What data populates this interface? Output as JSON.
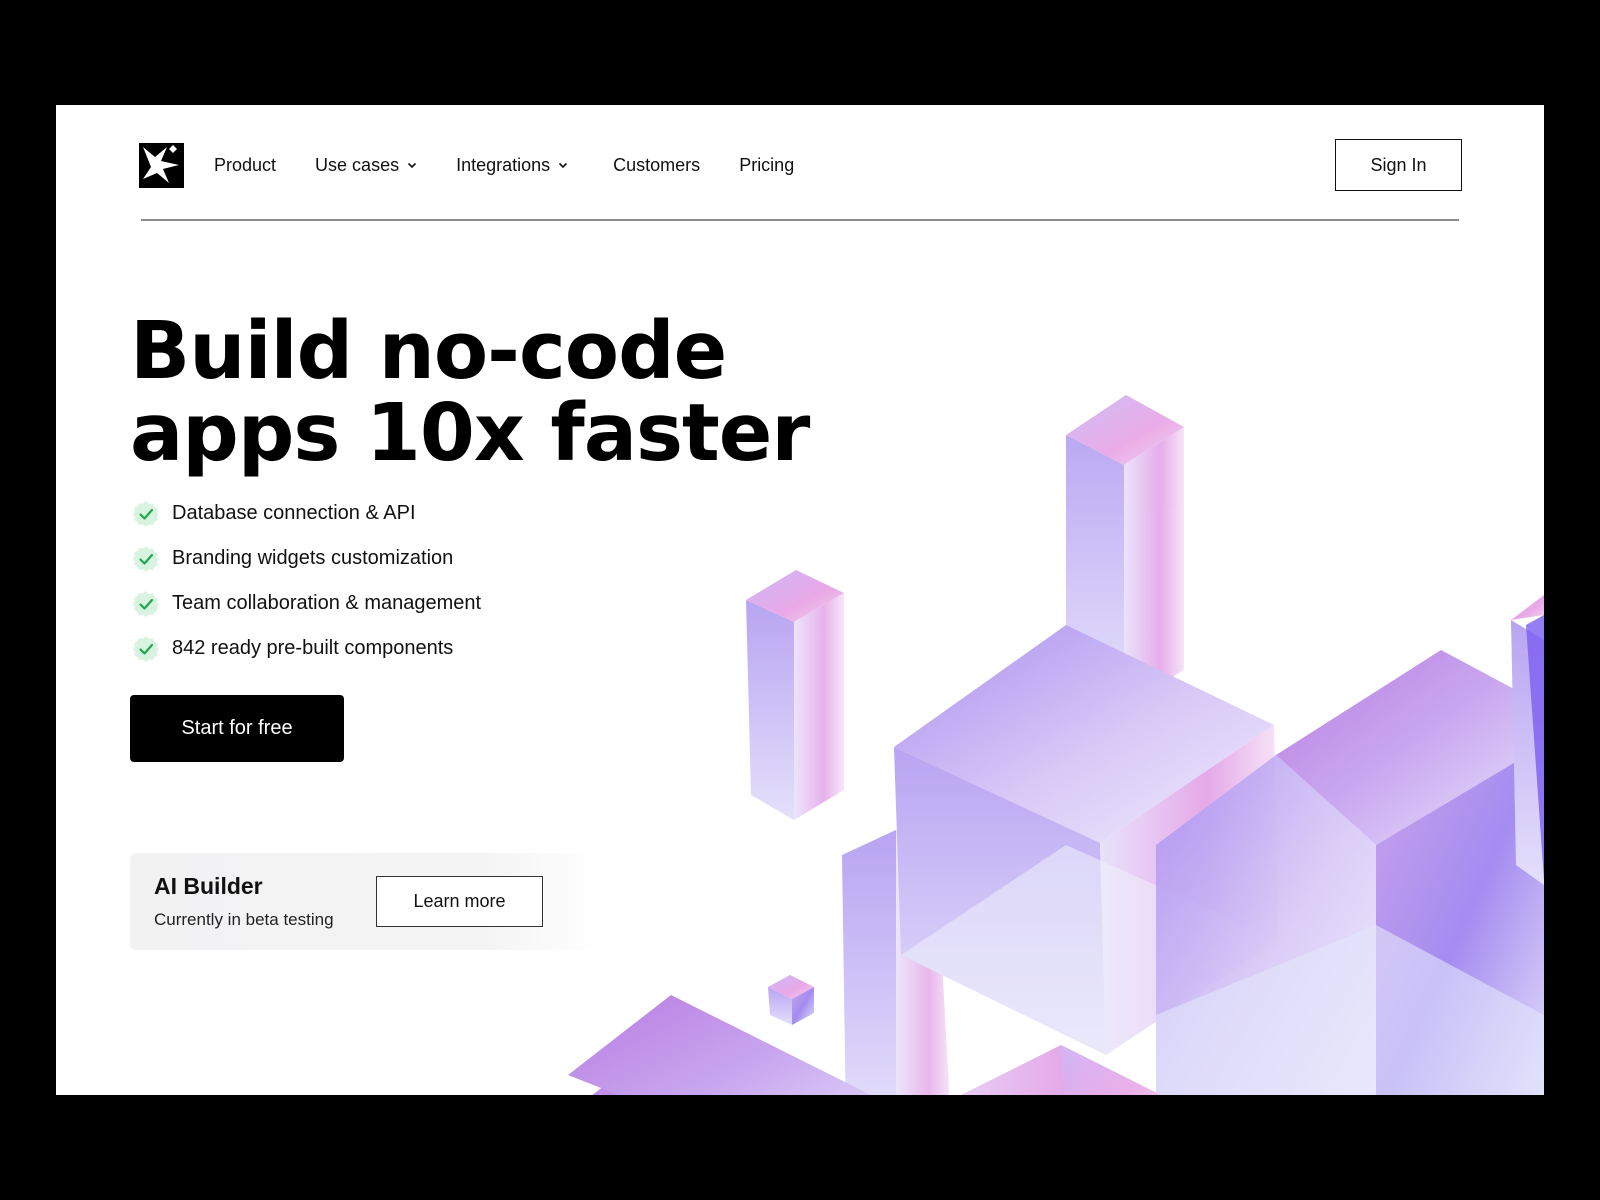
{
  "nav": {
    "items": [
      {
        "label": "Product",
        "has_dropdown": false
      },
      {
        "label": "Use cases",
        "has_dropdown": true
      },
      {
        "label": "Integrations",
        "has_dropdown": true
      },
      {
        "label": "Customers",
        "has_dropdown": false
      },
      {
        "label": "Pricing",
        "has_dropdown": false
      }
    ],
    "sign_in_label": "Sign In"
  },
  "hero": {
    "title_line1": "Build no-code",
    "title_line2": "apps 10x faster",
    "features": [
      "Database connection & API",
      "Branding widgets customization",
      "Team collaboration & management",
      "842 ready pre-built components"
    ],
    "cta_label": "Start for free"
  },
  "ai_card": {
    "title": "AI Builder",
    "subtitle": "Currently in beta testing",
    "button_label": "Learn more"
  },
  "icons": {
    "logo": "sparkle-logo-icon",
    "dropdown": "chevron-down-icon",
    "feature_check": "check-badge-icon"
  },
  "colors": {
    "primary": "#000000",
    "check_green": "#1fa84f",
    "check_bg": "#d9f3e1",
    "art_violet": "#9b7bf0",
    "art_pink": "#e9a8e6"
  }
}
